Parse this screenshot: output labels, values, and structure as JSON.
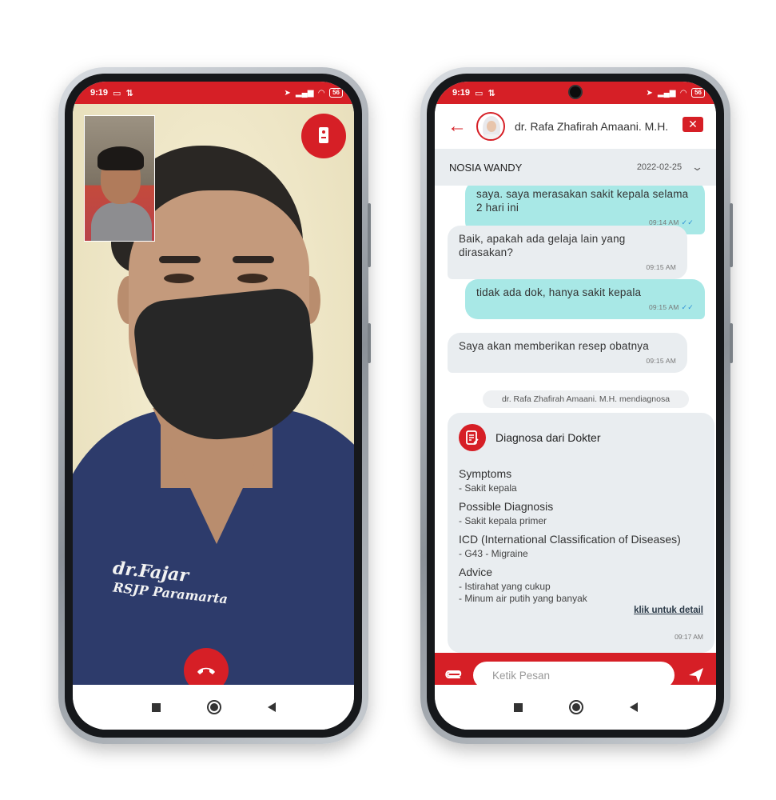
{
  "status_bar": {
    "time": "9:19",
    "battery": "56"
  },
  "video_call": {
    "shirt_name": "dr.Fajar",
    "shirt_hospital": "RSJP Paramarta"
  },
  "chat": {
    "header": {
      "doctor_name": "dr. Rafa Zhafirah Amaani. M.H."
    },
    "patient": {
      "name": "NOSIA WANDY",
      "date": "2022-02-25"
    },
    "messages": [
      {
        "side": "out",
        "text": "saya. saya merasakan sakit kepala selama 2 hari ini",
        "time": "09:14 AM"
      },
      {
        "side": "in",
        "text": "Baik, apakah ada gelaja lain yang dirasakan?",
        "time": "09:15 AM"
      },
      {
        "side": "out",
        "text": "tidak ada dok, hanya sakit kepala",
        "time": "09:15 AM"
      },
      {
        "side": "in",
        "text": "Saya akan memberikan resep obatnya",
        "time": "09:15 AM"
      }
    ],
    "system_note": "dr. Rafa Zhafirah Amaani. M.H. mendiagnosa",
    "diagnosis": {
      "title": "Diagnosa dari Dokter",
      "sections": [
        {
          "heading": "Symptoms",
          "items": [
            "- Sakit kepala"
          ]
        },
        {
          "heading": "Possible Diagnosis",
          "items": [
            "- Sakit kepala primer"
          ]
        },
        {
          "heading": "ICD (International Classification of Diseases)",
          "items": [
            "- G43 - Migraine"
          ]
        },
        {
          "heading": "Advice",
          "items": [
            "- Istirahat yang cukup",
            "- Minum air putih yang banyak"
          ]
        }
      ],
      "detail_link": "klik untuk detail",
      "time": "09:17 AM"
    },
    "input": {
      "placeholder": "Ketik Pesan"
    }
  },
  "colors": {
    "brand_red": "#d61f26",
    "outgoing_bubble": "#a8e8e6",
    "incoming_bubble": "#e9edf0"
  },
  "icons": [
    "laptop-icon",
    "signal-icon",
    "wifi-icon",
    "location-icon",
    "switch-camera-icon",
    "hangup-icon",
    "back-arrow-icon",
    "end-chat-icon",
    "chevron-down-icon",
    "prescription-icon",
    "attach-icon",
    "send-icon"
  ]
}
